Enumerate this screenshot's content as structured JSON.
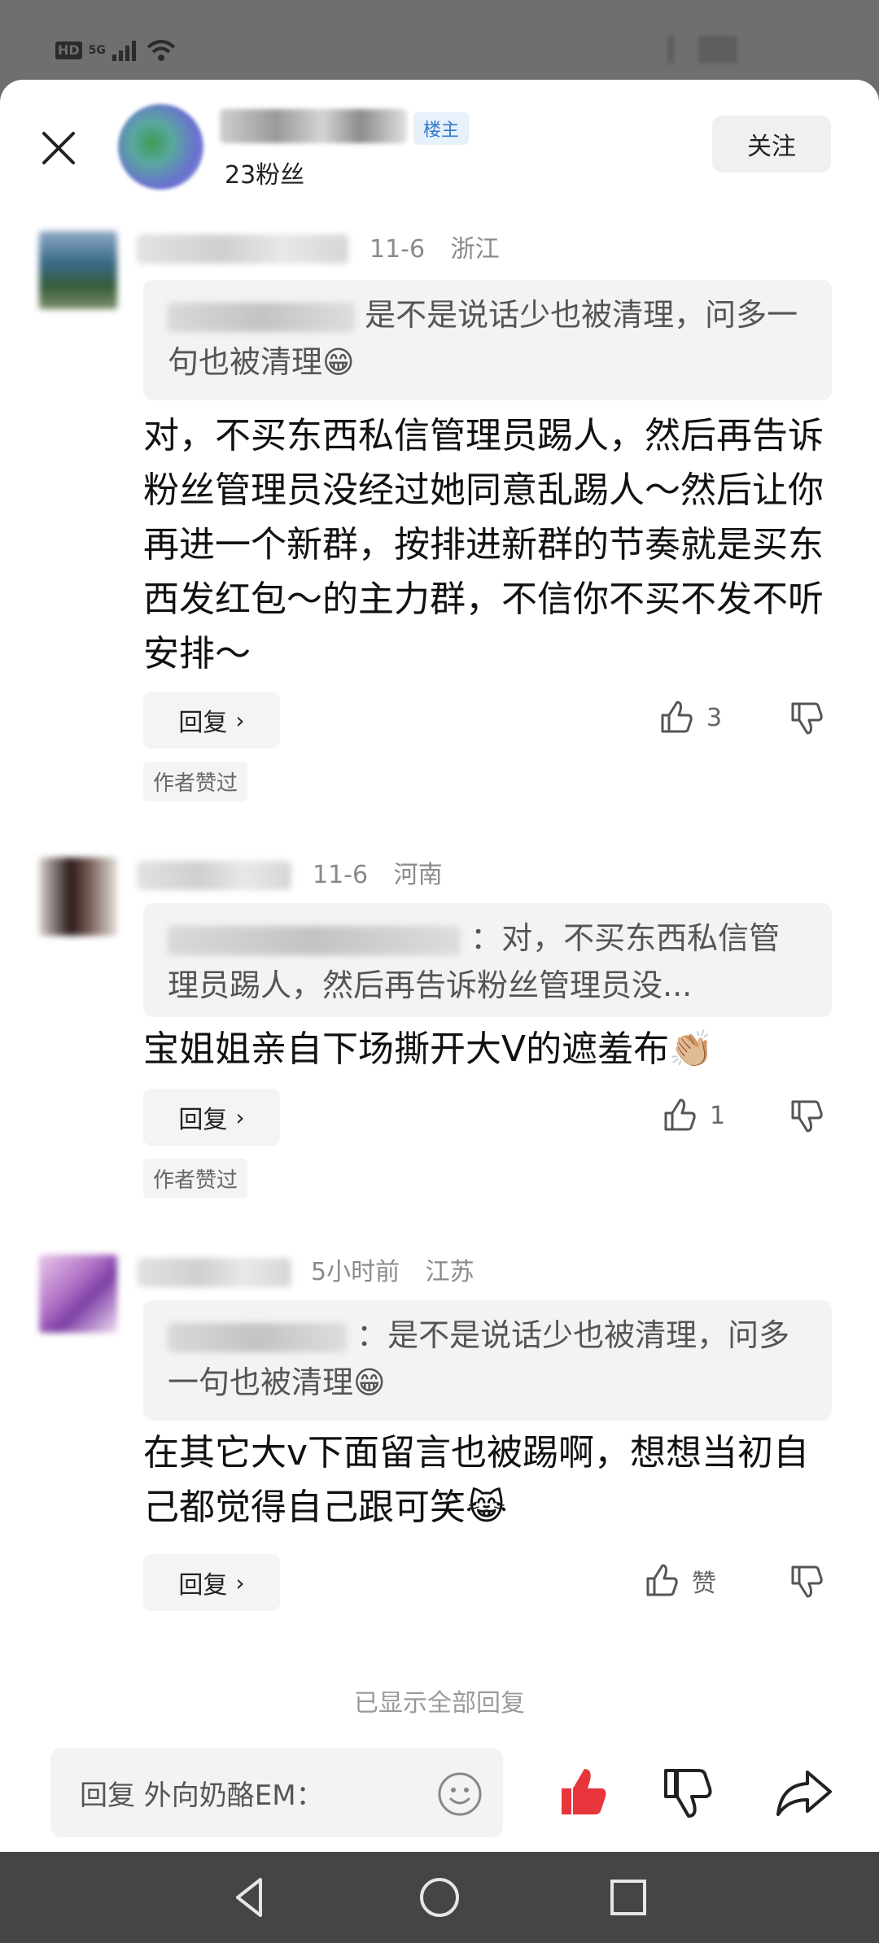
{
  "status_bar": {
    "network": "HD",
    "signal": "5G"
  },
  "header": {
    "badge": "楼主",
    "fans": "23粉丝",
    "follow_label": "关注"
  },
  "comments": [
    {
      "date": "11-6",
      "location": "浙江",
      "quote_text": "是不是说话少也被清理，问多一句也被清理😁",
      "body": "对，不买东西私信管理员踢人，然后再告诉粉丝管理员没经过她同意乱踢人～然后让你再进一个新群，按排进新群的节奏就是买东西发红包～的主力群，不信你不买不发不听安排～",
      "reply_label": "回复",
      "likes": "3",
      "author_liked": "作者赞过"
    },
    {
      "date": "11-6",
      "location": "河南",
      "quote_text": "：对，不买东西私信管理员踢人，然后再告诉粉丝管理员没...",
      "body": "宝姐姐亲自下场撕开大V的遮羞布👏🏼",
      "reply_label": "回复",
      "likes": "1",
      "author_liked": "作者赞过"
    },
    {
      "date": "5小时前",
      "location": "江苏",
      "quote_text": "：是不是说话少也被清理，问多一句也被清理😁",
      "body": "在其它大v下面留言也被踢啊，想想当初自己都觉得自己跟可笑😹",
      "reply_label": "回复",
      "likes": "赞"
    }
  ],
  "footer_note": "已显示全部回复",
  "reply_input": {
    "placeholder": "回复 外向奶酪EM："
  },
  "colors": {
    "accent_red": "#e8353b",
    "badge_blue": "#2f79c9"
  }
}
